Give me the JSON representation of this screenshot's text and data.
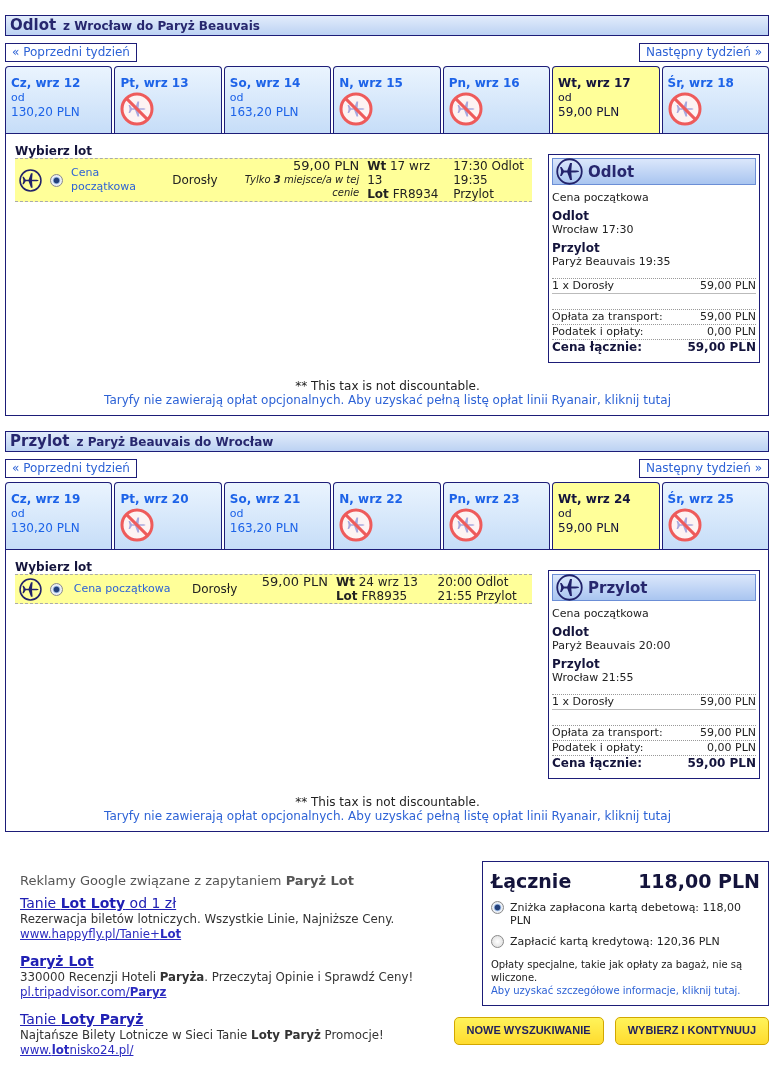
{
  "legs": [
    {
      "title": "Odlot",
      "route": "z Wrocław do Paryż Beauvais",
      "prev_week": "« Poprzedni tydzień",
      "next_week": "Następny tydzień »",
      "days": [
        {
          "label": "Cz, wrz 12",
          "available": true,
          "from": "od",
          "price": "130,20 PLN",
          "selected": false
        },
        {
          "label": "Pt, wrz 13",
          "available": false,
          "selected": false
        },
        {
          "label": "So, wrz 14",
          "available": true,
          "from": "od",
          "price": "163,20 PLN",
          "selected": false
        },
        {
          "label": "N, wrz 15",
          "available": false,
          "selected": false
        },
        {
          "label": "Pn, wrz 16",
          "available": false,
          "selected": false
        },
        {
          "label": "Wt, wrz 17",
          "available": true,
          "from": "od",
          "price": "59,00 PLN",
          "selected": true
        },
        {
          "label": "Śr, wrz 18",
          "available": false,
          "selected": false
        }
      ],
      "choose_label": "Wybierz lot",
      "flights": [
        {
          "selected": true,
          "fare": "Cena początkowa",
          "passenger": "Dorosły",
          "price": "59,00 PLN",
          "seats_note": "Tylko **3** miejsce/a w tej cenie",
          "date": "**Wt** 17 wrz 13",
          "flight": "**Lot** FR8934",
          "departure": "17:30 Odlot",
          "arrival": "19:35 Przylot"
        }
      ],
      "summary": {
        "title": "Odlot",
        "fare": "Cena początkowa",
        "departure_heading": "Odlot",
        "departure_detail": "Wrocław 17:30",
        "arrival_heading": "Przylot",
        "arrival_detail": "Paryż Beauvais 19:35",
        "passengers": [
          {
            "label": "1 x Dorosły",
            "value": "59,00 PLN"
          }
        ],
        "charges": [
          {
            "label": "Opłata za transport:",
            "value": "59,00 PLN"
          },
          {
            "label": "Podatek i opłaty:",
            "value": "0,00 PLN"
          }
        ],
        "total_label": "Cena łącznie:",
        "total_value": "59,00 PLN"
      },
      "tax_note": "** This tax is not discountable.",
      "fees_link": "Taryfy nie zawierają opłat opcjonalnych. Aby uzyskać pełną listę opłat linii Ryanair, kliknij tutaj"
    },
    {
      "title": "Przylot",
      "route": "z Paryż Beauvais do Wrocław",
      "prev_week": "« Poprzedni tydzień",
      "next_week": "Następny tydzień »",
      "days": [
        {
          "label": "Cz, wrz 19",
          "available": true,
          "from": "od",
          "price": "130,20 PLN",
          "selected": false
        },
        {
          "label": "Pt, wrz 20",
          "available": false,
          "selected": false
        },
        {
          "label": "So, wrz 21",
          "available": true,
          "from": "od",
          "price": "163,20 PLN",
          "selected": false
        },
        {
          "label": "N, wrz 22",
          "available": false,
          "selected": false
        },
        {
          "label": "Pn, wrz 23",
          "available": false,
          "selected": false
        },
        {
          "label": "Wt, wrz 24",
          "available": true,
          "from": "od",
          "price": "59,00 PLN",
          "selected": true
        },
        {
          "label": "Śr, wrz 25",
          "available": false,
          "selected": false
        }
      ],
      "choose_label": "Wybierz lot",
      "flights": [
        {
          "selected": true,
          "fare": "Cena początkowa",
          "passenger": "Dorosły",
          "price": "59,00 PLN",
          "date": "**Wt** 24 wrz 13",
          "flight": "**Lot** FR8935",
          "departure": "20:00 Odlot",
          "arrival": "21:55 Przylot"
        }
      ],
      "summary": {
        "title": "Przylot",
        "fare": "Cena początkowa",
        "departure_heading": "Odlot",
        "departure_detail": "Paryż Beauvais 20:00",
        "arrival_heading": "Przylot",
        "arrival_detail": "Wrocław 21:55",
        "passengers": [
          {
            "label": "1 x Dorosły",
            "value": "59,00 PLN"
          }
        ],
        "charges": [
          {
            "label": "Opłata za transport:",
            "value": "59,00 PLN"
          },
          {
            "label": "Podatek i opłaty:",
            "value": "0,00 PLN"
          }
        ],
        "total_label": "Cena łącznie:",
        "total_value": "59,00 PLN"
      },
      "tax_note": "** This tax is not discountable.",
      "fees_link": "Taryfy nie zawierają opłat opcjonalnych. Aby uzyskać pełną listę opłat linii Ryanair, kliknij tutaj"
    }
  ],
  "ads": {
    "heading": "Reklamy Google związane z zapytaniem **Paryż Lot**",
    "items": [
      {
        "title": "Tanie **Lot Loty** od 1 zł",
        "bold": false,
        "text": "Rezerwacja biletów lotniczych. Wszystkie Linie, Najniższe Ceny.",
        "url": "www.happyfly.pl/Tanie+**Lot**"
      },
      {
        "title": "Paryż Lot",
        "bold": true,
        "text": "330000 Recenzji Hoteli **Paryża**. Przeczytaj Opinie i Sprawdź Ceny!",
        "url": "pl.tripadvisor.com/**Paryz**"
      },
      {
        "title": "Tanie **Loty Paryż**",
        "bold": false,
        "text": "Najtańsze Bilety Lotnicze w Sieci Tanie **Loty Paryż** Promocje!",
        "url": "www.**lot**nisko24.pl/"
      }
    ]
  },
  "total": {
    "label": "Łącznie",
    "value": "118,00 PLN",
    "payment_options": [
      {
        "text": "Zniżka zapłacona kartą debetową: 118,00 PLN",
        "selected": true
      },
      {
        "text": "Zapłacić kartą kredytową: 120,36 PLN",
        "selected": false
      }
    ],
    "note": "Opłaty specjalne, takie jak opłaty za bagaż, nie są wliczone.",
    "note_link": "Aby uzyskać szczegółowe informacje, kliknij tutaj."
  },
  "buttons": [
    "NOWE WYSZUKIWANIE",
    "WYBIERZ I KONTYNUUJ"
  ]
}
